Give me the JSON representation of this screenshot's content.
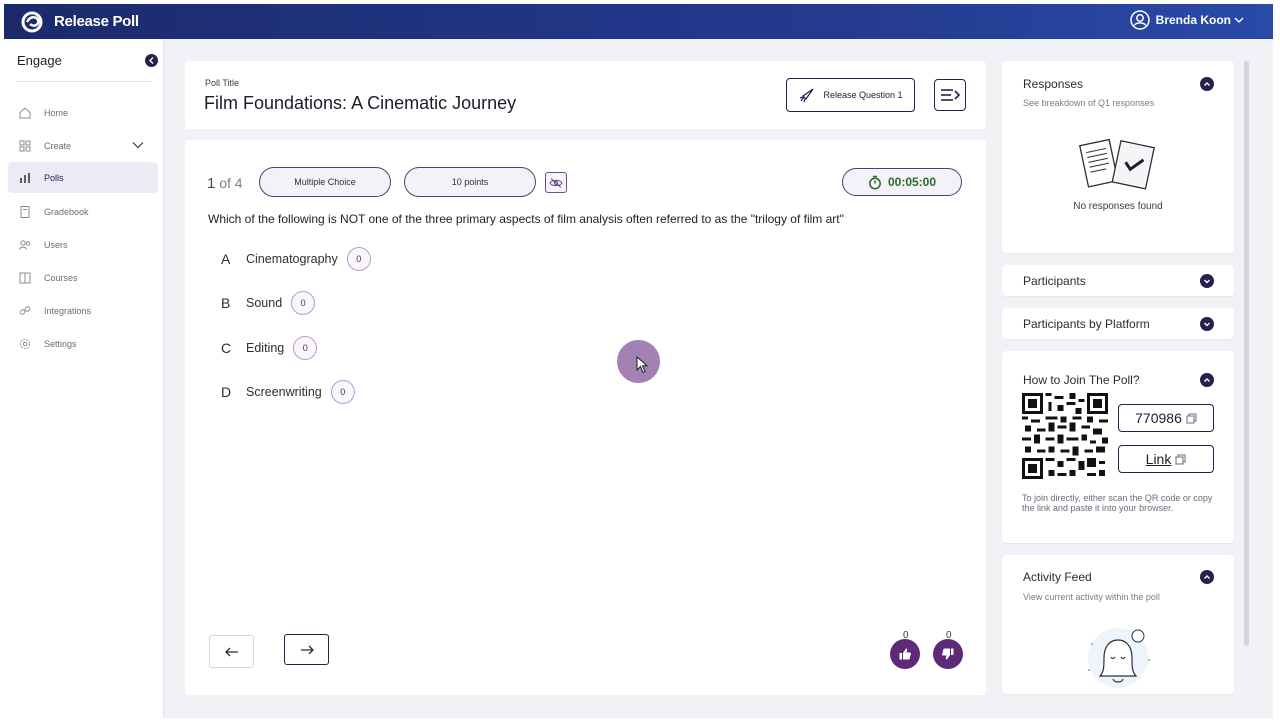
{
  "app": {
    "title": "Release Poll",
    "user_name": "Brenda Koon"
  },
  "sidebar": {
    "heading": "Engage",
    "items": [
      {
        "label": "Home",
        "icon": "home-icon"
      },
      {
        "label": "Create",
        "icon": "grid-icon"
      },
      {
        "label": "Polls",
        "icon": "bar-chart-icon"
      },
      {
        "label": "Gradebook",
        "icon": "book-icon"
      },
      {
        "label": "Users",
        "icon": "users-icon"
      },
      {
        "label": "Courses",
        "icon": "courses-icon"
      },
      {
        "label": "Integrations",
        "icon": "link-icon"
      },
      {
        "label": "Settings",
        "icon": "gear-icon"
      }
    ],
    "active_item": "Polls"
  },
  "poll": {
    "label": "Poll Title",
    "title": "Film Foundations: A Cinematic Journey",
    "release_button": "Release Question 1"
  },
  "question": {
    "index": "1",
    "of_text": "of 4",
    "type": "Multiple Choice",
    "points": "10 points",
    "timer": "00:05:00",
    "text": "Which of the following is NOT one of the three primary aspects of film analysis often referred to as the \"trilogy of film art\"",
    "options": [
      {
        "letter": "A",
        "text": "Cinematography",
        "count": "0"
      },
      {
        "letter": "B",
        "text": "Sound",
        "count": "0"
      },
      {
        "letter": "C",
        "text": "Editing",
        "count": "0"
      },
      {
        "letter": "D",
        "text": "Screenwriting",
        "count": "0"
      }
    ],
    "likes": "0",
    "dislikes": "0"
  },
  "panels": {
    "responses": {
      "title": "Responses",
      "subtitle": "See breakdown of Q1 responses",
      "empty": "No responses found"
    },
    "participants": {
      "title": "Participants"
    },
    "participants_platform": {
      "title": "Participants by Platform"
    },
    "join": {
      "title": "How to Join The Poll?",
      "code": "770986",
      "link_label": "Link",
      "help": "To join directly, either scan the QR code or copy the link and paste it into your browser."
    },
    "activity": {
      "title": "Activity Feed",
      "subtitle": "View current activity within the poll"
    }
  },
  "colors": {
    "brand_dark": "#2b1f4e",
    "accent_purple": "#5e2a78",
    "topbar": "#1f3380",
    "timer_green": "#2a6b2a"
  }
}
